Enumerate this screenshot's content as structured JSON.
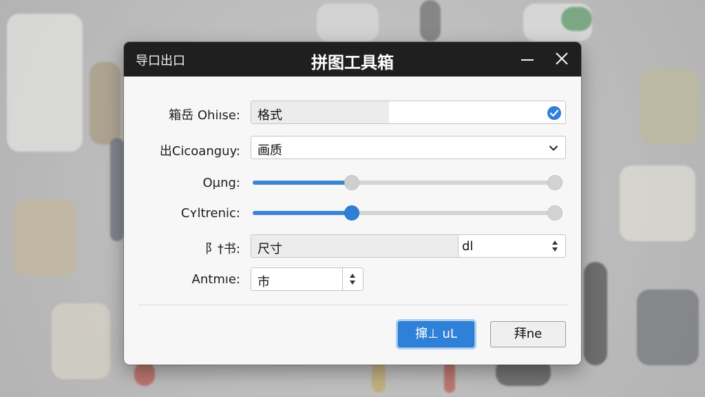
{
  "window": {
    "left_label": "导口出口",
    "title": "拼图工具箱"
  },
  "form": {
    "format": {
      "label": "箱岳 Ohiıse:",
      "value": "格式",
      "checked": true
    },
    "quality": {
      "label": "出Cicoanguy:",
      "value": "画质"
    },
    "slider1": {
      "label": "Oµng:",
      "level": 0.31
    },
    "slider2": {
      "label": "Cʏltrenic:",
      "level": 0.31
    },
    "size": {
      "label": "阝†书:",
      "value": "尺寸",
      "unit": "dl"
    },
    "amount": {
      "label": "Antmıe:",
      "value": "市"
    }
  },
  "buttons": {
    "primary_label": "撺⊥ uL",
    "secondary_label": "拜ne"
  },
  "colors": {
    "accent": "#2f80d8",
    "titlebar": "#1f1f1f"
  },
  "icons": [
    "minimize-icon",
    "close-icon",
    "check-circle-icon",
    "chevron-down-icon",
    "spinner-arrows-icon"
  ]
}
